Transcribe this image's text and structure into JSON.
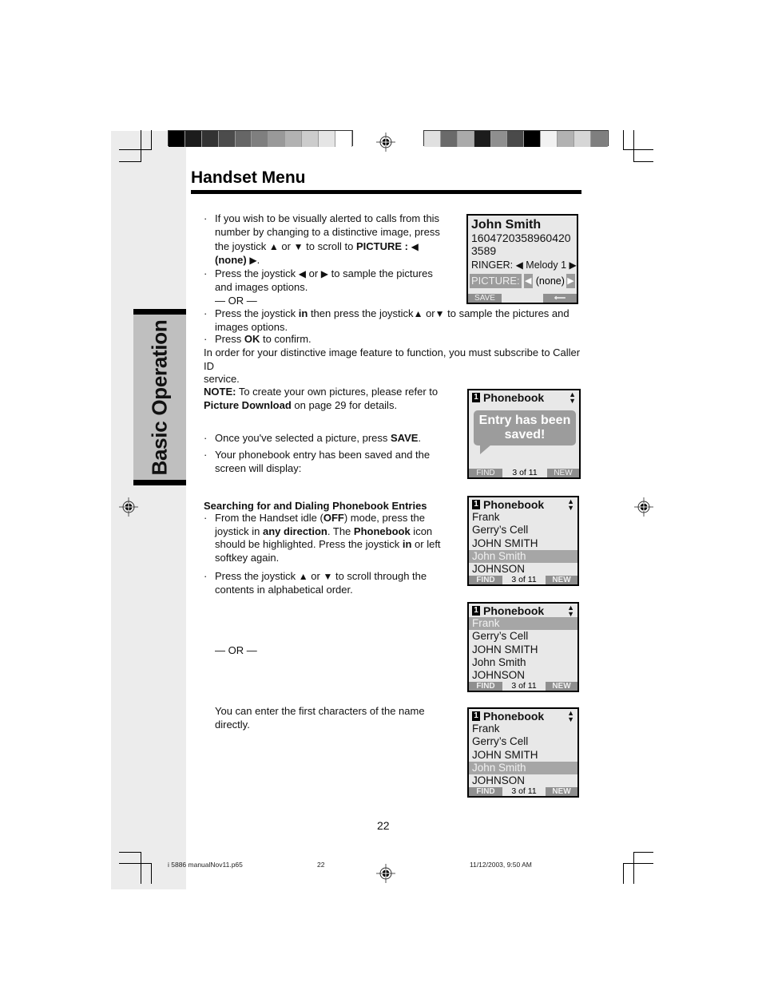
{
  "page": {
    "section_tab": "Basic Operation",
    "title": "Handset Menu",
    "page_number": "22"
  },
  "calibration": {
    "left_swatches": [
      "#000000",
      "#1c1c1c",
      "#333333",
      "#4c4c4c",
      "#666666",
      "#7f7f7f",
      "#999999",
      "#b2b2b2",
      "#cccccc",
      "#e5e5e5",
      "#ffffff"
    ],
    "right_swatches": [
      "#e0e0e0",
      "#6a6a6a",
      "#aaaaaa",
      "#1c1c1c",
      "#8f8f8f",
      "#4a4a4a",
      "#000000",
      "#f2f2f2",
      "#b2b2b2",
      "#d6d6d6",
      "#7f7f7f"
    ]
  },
  "section1": {
    "b1_a": "If you wish to be visually alerted to calls from this",
    "b1_b": "number by changing to a distinctive image, press",
    "b1_c1": "the joystick ",
    "b1_c2": " or ",
    "b1_c3": "  to scroll to ",
    "b1_c4": "PICTURE : ",
    "b1_d": "(none) ",
    "b2_a1": "Press the joystick ",
    "b2_a2": " or ",
    "b2_a3": " to sample the pictures",
    "b2_b": "and images options.",
    "or1": "—  OR  —",
    "b3_a1": "Press the joystick ",
    "b3_a2": "in",
    "b3_a3": " then press the joystick",
    "b3_a4": "  or",
    "b3_a5": "  to sample the pictures and",
    "b3_b": "images options.",
    "b4_a": "Press ",
    "b4_b": "OK",
    "b4_c": " to confirm.",
    "para1": "In order for your distinctive image feature to function, you must subscribe to Caller ID",
    "para2": "service."
  },
  "note": {
    "label": "NOTE:",
    "text1": " To create your own pictures, please refer to",
    "link": "Picture Download",
    "text2": " on page 29 for details."
  },
  "section2": {
    "b1_a": "Once you've selected a picture, press ",
    "b1_b": "SAVE",
    "b1_c": ".",
    "b2_a": "Your phonebook entry has been saved and the",
    "b2_b": "screen will display:"
  },
  "section3": {
    "heading": "Searching for and Dialing Phonebook Entries",
    "b1_a1": "From the Handset idle (",
    "b1_a2": "OFF",
    "b1_a3": ") mode, press the",
    "b1_b1": "joystick in  ",
    "b1_b2": "any direction",
    "b1_b3": ". The ",
    "b1_b4": "Phonebook",
    "b1_b5": " icon",
    "b1_c1": "should be highlighted. Press the joystick ",
    "b1_c2": "in",
    "b1_c3": " or left",
    "b1_d": "softkey  again.",
    "b2_a1": "Press the joystick ",
    "b2_a2": " or ",
    "b2_a3": " to scroll through the",
    "b2_b": "contents in alphabetical order.",
    "or2": "—  OR  —",
    "direct1": "You can enter the first characters of the name",
    "direct2": "directly."
  },
  "glyphs": {
    "up": "▲",
    "down": "▼",
    "left": "◀",
    "right": "▶",
    "bullet": "·"
  },
  "screens": {
    "detail": {
      "name": "John Smith",
      "number_line1": "1604720358960420",
      "number_line2": "3589",
      "ringer_label": "RINGER:",
      "ringer_value": "Melody 1",
      "picture_label": "PICTURE:",
      "picture_value": "(none)",
      "softkey_left": "SAVE",
      "softkey_right": "⟵"
    },
    "saved": {
      "header_num": "1",
      "header": "Phonebook",
      "message": "Entry has been saved!",
      "softkey_left": "FIND",
      "count": "3 of 11",
      "softkey_right": "NEW"
    },
    "list_a": {
      "header_num": "1",
      "header": "Phonebook",
      "items": [
        "Frank",
        "Gerry’s  Cell",
        "JOHN SMITH",
        "John Smith",
        "JOHNSON"
      ],
      "selected_index": 3,
      "softkey_left": "FIND",
      "count": "3 of 11",
      "softkey_right": "NEW"
    },
    "list_b": {
      "header_num": "1",
      "header": "Phonebook",
      "items": [
        "Frank",
        "Gerry’s  Cell",
        "JOHN SMITH",
        "John Smith",
        "JOHNSON"
      ],
      "selected_index": 0,
      "softkey_left": "FIND",
      "count": "3 of 11",
      "softkey_right": "NEW"
    },
    "list_c": {
      "header_num": "1",
      "header": "Phonebook",
      "items": [
        "Frank",
        "Gerry’s  Cell",
        "JOHN SMITH",
        "John Smith",
        "JOHNSON"
      ],
      "selected_index": 3,
      "softkey_left": "FIND",
      "count": "3 of 11",
      "softkey_right": "NEW"
    }
  },
  "footer": {
    "file": "i 5886 manualNov11.p65",
    "page": "22",
    "timestamp": "11/12/2003, 9:50 AM"
  }
}
